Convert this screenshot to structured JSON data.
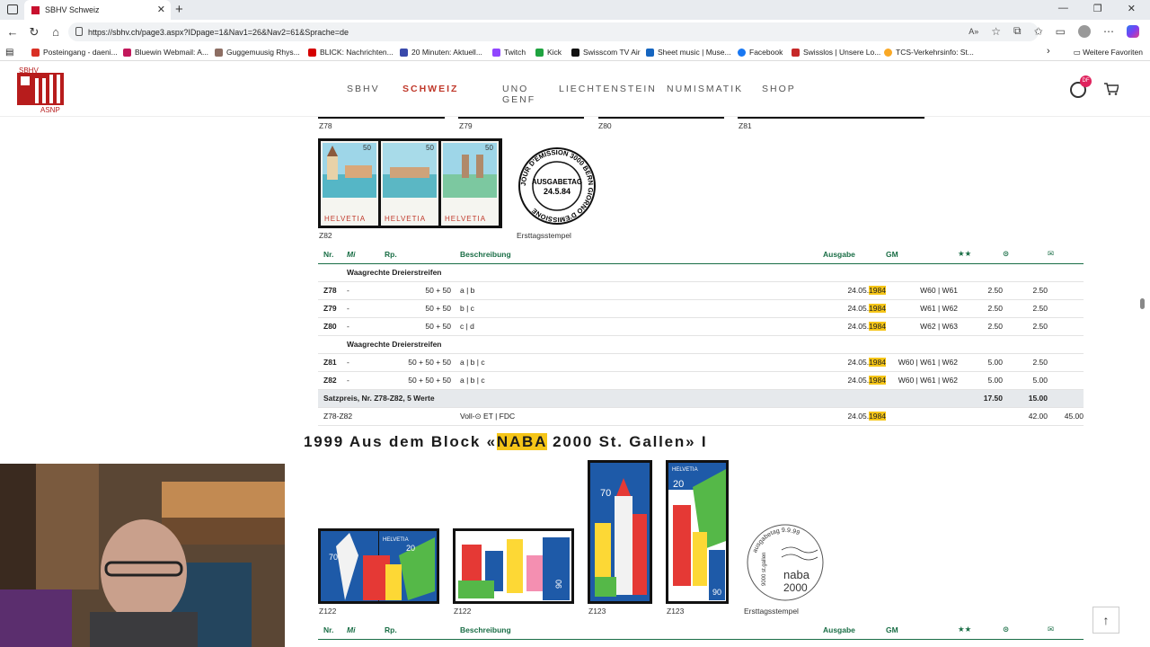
{
  "browser": {
    "tab_title": "SBHV Schweiz",
    "url": "https://sbhv.ch/page3.aspx?IDpage=1&Nav1=26&Nav2=61&Sprache=de",
    "bookmarks": [
      "Posteingang - daeni...",
      "Bluewin Webmail: A...",
      "Guggemuusig Rhys...",
      "BLICK: Nachrichten...",
      "20 Minuten: Aktuell...",
      "Twitch",
      "Kick",
      "Swisscom TV Air",
      "Sheet music | Muse...",
      "Facebook",
      "Swisslos | Unsere Lo...",
      "TCS-Verkehrsinfo: St..."
    ],
    "bookmarks_more": "Weitere Favoriten"
  },
  "site": {
    "logo_top": "SBHV",
    "logo_bottom": "ASNP",
    "nav": [
      "SBHV",
      "SCHWEIZ",
      "UNO GENF",
      "LIECHTENSTEIN",
      "NUMISMATIK",
      "SHOP"
    ],
    "active_nav": "SCHWEIZ",
    "user_badge": "DF",
    "accent": "#c0392b",
    "table_header_color": "#1a6e46",
    "highlight_color": "#f5c518"
  },
  "section1": {
    "top_captions": [
      "Z78",
      "Z79",
      "Z80",
      "Z81"
    ],
    "stamp_caption": "Z82",
    "stamp_labels": [
      "50",
      "50",
      "50"
    ],
    "stamp_country": "HELVETIA",
    "postmark_caption": "Ersttagsstempel",
    "postmark_text": "AUSGABETAG",
    "postmark_date": "24.5.84",
    "postmark_ring": "JOUR D'EMISSION 3000 BERN GIORNO D'EMISSIONE",
    "headers": {
      "nr": "Nr.",
      "mi": "Mi",
      "rp": "Rp.",
      "desc": "Beschreibung",
      "ausgabe": "Ausgabe",
      "gm": "GM",
      "stars": "★★",
      "used": "⊙",
      "fdc": "✉"
    },
    "rows": [
      {
        "type": "group",
        "label": "Waagrechte Dreierstreifen"
      },
      {
        "nr": "Z78",
        "mi": "-",
        "rp": "50 + 50",
        "desc": "a | b",
        "date": "24.05.",
        "year": "1984",
        "gm": "W60 | W61",
        "v1": "2.50",
        "v2": "2.50",
        "v3": ""
      },
      {
        "nr": "Z79",
        "mi": "-",
        "rp": "50 + 50",
        "desc": "b | c",
        "date": "24.05.",
        "year": "1984",
        "gm": "W61 | W62",
        "v1": "2.50",
        "v2": "2.50",
        "v3": ""
      },
      {
        "nr": "Z80",
        "mi": "-",
        "rp": "50 + 50",
        "desc": "c | d",
        "date": "24.05.",
        "year": "1984",
        "gm": "W62 | W63",
        "v1": "2.50",
        "v2": "2.50",
        "v3": ""
      },
      {
        "type": "group",
        "label": "Waagrechte Dreierstreifen"
      },
      {
        "nr": "Z81",
        "mi": "-",
        "rp": "50 + 50 + 50",
        "desc": "a | b | c",
        "date": "24.05.",
        "year": "1984",
        "gm": "W60 | W61 | W62",
        "v1": "5.00",
        "v2": "2.50",
        "v3": ""
      },
      {
        "nr": "Z82",
        "mi": "-",
        "rp": "50 + 50 + 50",
        "desc": "a | b | c",
        "date": "24.05.",
        "year": "1984",
        "gm": "W60 | W61 | W62",
        "v1": "5.00",
        "v2": "5.00",
        "v3": ""
      },
      {
        "type": "sum",
        "label": "Satzpreis, Nr. Z78-Z82, 5 Werte",
        "v1": "17.50",
        "v2": "15.00"
      },
      {
        "type": "fdc",
        "nr": "Z78-Z82",
        "desc": "Voll-⊙ ET | FDC",
        "date": "24.05.",
        "year": "1984",
        "v2": "42.00",
        "v3": "45.00"
      }
    ]
  },
  "section2": {
    "title_pre": "1999 Aus dem Block «",
    "title_hl": "NABA",
    "title_post": " 2000 St. Gallen» I",
    "captions": [
      "Z122",
      "Z122",
      "Z123",
      "Z123"
    ],
    "postmark_caption": "Ersttagsstempel",
    "postmark_top": "ausgabetag 9.9.99",
    "postmark_side": "9000 st.gallen",
    "postmark_brand": "naba",
    "postmark_year": "2000",
    "stamp_values": [
      "70",
      "20",
      "90",
      "70",
      "20",
      "90"
    ],
    "stamp_country": "HELVETIA",
    "headers": {
      "nr": "Nr.",
      "mi": "Mi",
      "rp": "Rp.",
      "desc": "Beschreibung",
      "ausgabe": "Ausgabe",
      "gm": "GM",
      "stars": "★★",
      "used": "⊙",
      "fdc": "✉"
    }
  }
}
